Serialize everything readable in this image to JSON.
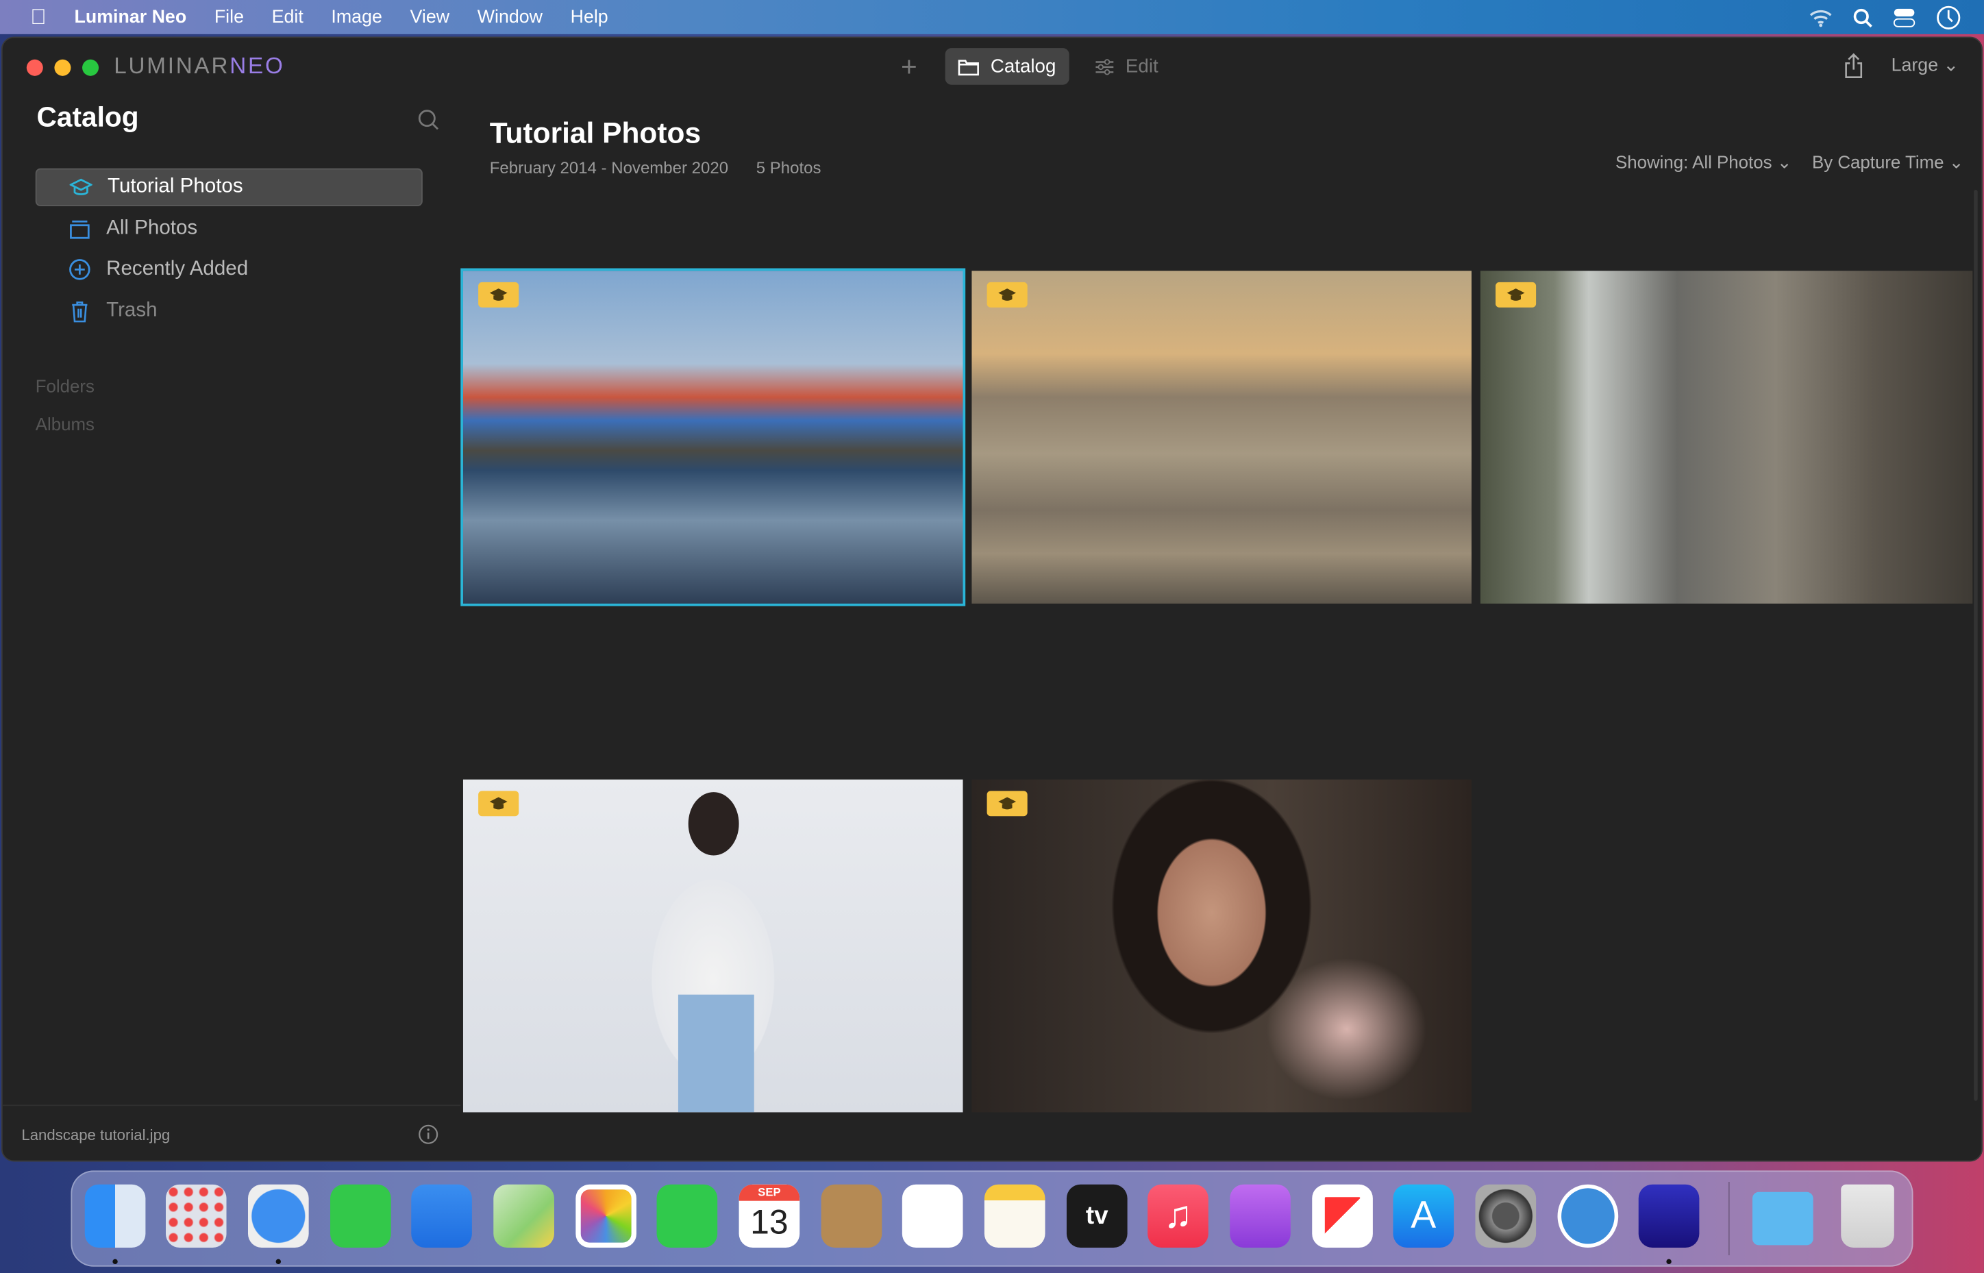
{
  "menubar": {
    "app": "Luminar Neo",
    "items": [
      "File",
      "Edit",
      "Image",
      "View",
      "Window",
      "Help"
    ]
  },
  "window": {
    "logo_a": "LUMINAR",
    "logo_b": "NEO",
    "nav": {
      "catalog": "Catalog",
      "edit": "Edit"
    },
    "size": "Large"
  },
  "sidebar": {
    "title": "Catalog",
    "items": [
      {
        "label": "Tutorial Photos"
      },
      {
        "label": "All Photos"
      },
      {
        "label": "Recently Added"
      },
      {
        "label": "Trash"
      }
    ],
    "sections": [
      "Folders",
      "Albums"
    ],
    "footer_file": "Landscape tutorial.jpg"
  },
  "main": {
    "title": "Tutorial Photos",
    "date_range": "February 2014 - November 2020",
    "count": "5 Photos",
    "showing": "Showing: All Photos",
    "sort": "By Capture Time"
  },
  "colors": {
    "accent": "#2bb5d8",
    "badge": "#f5c242"
  },
  "photos": [
    {
      "subject": "harbor houses reflection"
    },
    {
      "subject": "beach sunset"
    },
    {
      "subject": "city street taxis"
    },
    {
      "subject": "woman white blouse"
    },
    {
      "subject": "woman portrait"
    }
  ],
  "dock": {
    "calendar_month": "SEP",
    "calendar_day": "13",
    "tv": "tv"
  }
}
